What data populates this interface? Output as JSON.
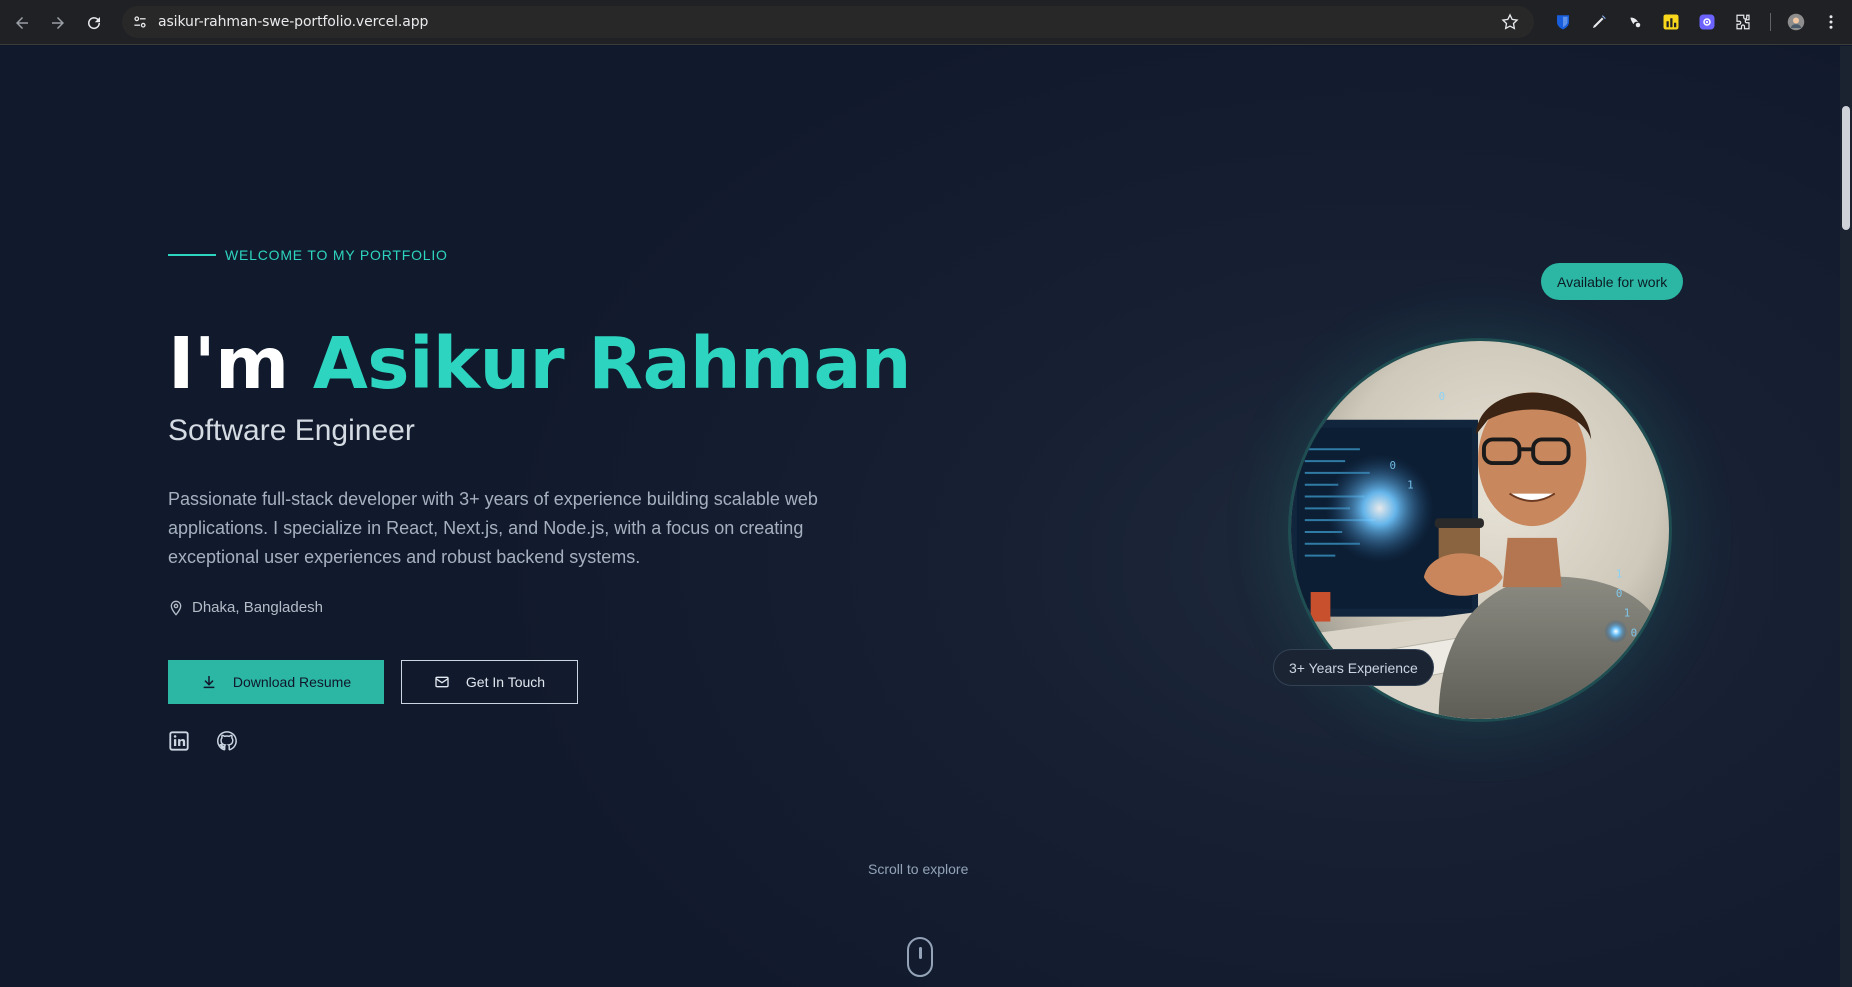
{
  "browser": {
    "url": "asikur-rahman-swe-portfolio.vercel.app",
    "icons": [
      "back-icon",
      "forward-icon",
      "reload-icon",
      "site-info-icon",
      "bookmark-star-icon",
      "bitwarden-icon",
      "pen-icon",
      "extension-icon",
      "metrics-icon",
      "settings-extension-icon",
      "puzzle-icon",
      "profile-avatar",
      "menu-icon"
    ]
  },
  "hero": {
    "eyebrow": "WELCOME TO MY PORTFOLIO",
    "greeting": "I'm ",
    "name": "Asikur Rahman",
    "role": "Software Engineer",
    "bio": "Passionate full-stack developer with 3+ years of experience building scalable web applications. I specialize in React, Next.js, and Node.js, with a focus on creating exceptional user experiences and robust backend systems.",
    "location": "Dhaka, Bangladesh",
    "buttons": {
      "download": "Download Resume",
      "contact": "Get In Touch"
    },
    "social": [
      "linkedin-icon",
      "github-icon"
    ]
  },
  "portrait": {
    "badge_available": "Available for work",
    "badge_experience": "3+ Years Experience"
  },
  "scroll_hint": "Scroll to explore",
  "colors": {
    "accent": "#2dd4bf",
    "button": "#2bb7a4",
    "background": "#172033"
  }
}
